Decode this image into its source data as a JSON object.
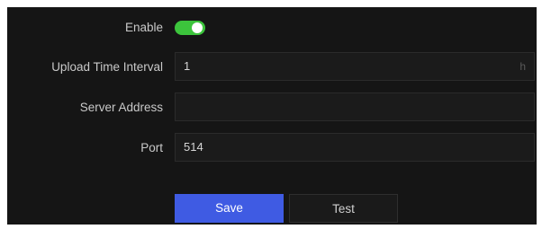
{
  "form": {
    "enable": {
      "label": "Enable",
      "value": true
    },
    "upload_interval": {
      "label": "Upload Time Interval",
      "value": "1",
      "unit": "h"
    },
    "server_address": {
      "label": "Server Address",
      "value": ""
    },
    "port": {
      "label": "Port",
      "value": "514"
    }
  },
  "buttons": {
    "save": "Save",
    "test": "Test"
  },
  "colors": {
    "background": "#151515",
    "toggle_on": "#3cc43c",
    "primary_button": "#3f5be3"
  }
}
